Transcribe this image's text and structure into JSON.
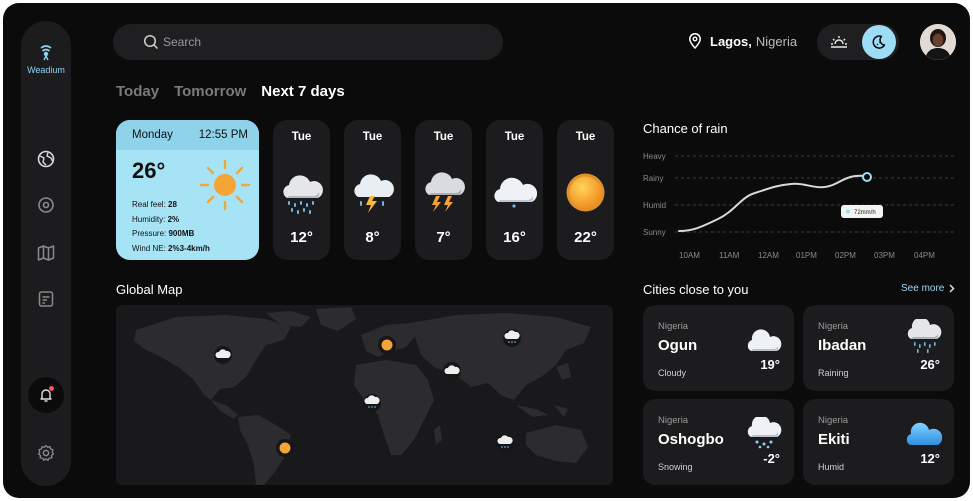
{
  "app": {
    "name": "Weadium"
  },
  "search": {
    "placeholder": "Search"
  },
  "location": {
    "city": "Lagos,",
    "country": "Nigeria"
  },
  "tabs": [
    {
      "label": "Today",
      "active": false
    },
    {
      "label": "Tomorrow",
      "active": false
    },
    {
      "label": "Next 7 days",
      "active": true
    }
  ],
  "today": {
    "day": "Monday",
    "time": "12:55 PM",
    "temp": "26°",
    "icon": "sun-icon",
    "details": [
      {
        "label": "Real feel:",
        "value": "28"
      },
      {
        "label": "Humidity:",
        "value": "2%"
      },
      {
        "label": "Pressure:",
        "value": "900MB"
      },
      {
        "label": "Wind NE:",
        "value": "2%3-4km/h"
      }
    ]
  },
  "forecast": [
    {
      "day": "Tue",
      "temp": "12°",
      "icon": "rain-cloud-icon"
    },
    {
      "day": "Tue",
      "temp": "8°",
      "icon": "thunder-rain-icon"
    },
    {
      "day": "Tue",
      "temp": "7°",
      "icon": "thunderstorm-icon"
    },
    {
      "day": "Tue",
      "temp": "16°",
      "icon": "cloud-icon"
    },
    {
      "day": "Tue",
      "temp": "22°",
      "icon": "sun-icon"
    }
  ],
  "rain": {
    "title": "Chance of rain",
    "levels": [
      "Heavy",
      "Rainy",
      "Humid",
      "Sunny"
    ],
    "times": [
      "10AM",
      "11AM",
      "12AM",
      "01PM",
      "02PM",
      "03PM",
      "04PM"
    ],
    "tooltip": "72mm/h"
  },
  "map": {
    "title": "Global Map"
  },
  "cities": {
    "title": "Cities close to you",
    "see_more": "See more",
    "items": [
      {
        "country": "Nigeria",
        "name": "Ogun",
        "condition": "Cloudy",
        "temp": "19°",
        "icon": "cloud-icon"
      },
      {
        "country": "Nigeria",
        "name": "Ibadan",
        "condition": "Raining",
        "temp": "26°",
        "icon": "rain-cloud-icon"
      },
      {
        "country": "Nigeria",
        "name": "Oshogbo",
        "condition": "Snowing",
        "temp": "-2°",
        "icon": "snow-cloud-icon"
      },
      {
        "country": "Nigeria",
        "name": "Ekiti",
        "condition": "Humid",
        "temp": "12°",
        "icon": "blue-cloud-icon"
      }
    ]
  },
  "colors": {
    "accent": "#9ddcf5",
    "background": "#0b0b0c",
    "card": "#1c1c1e",
    "sun": "#f7a234"
  }
}
